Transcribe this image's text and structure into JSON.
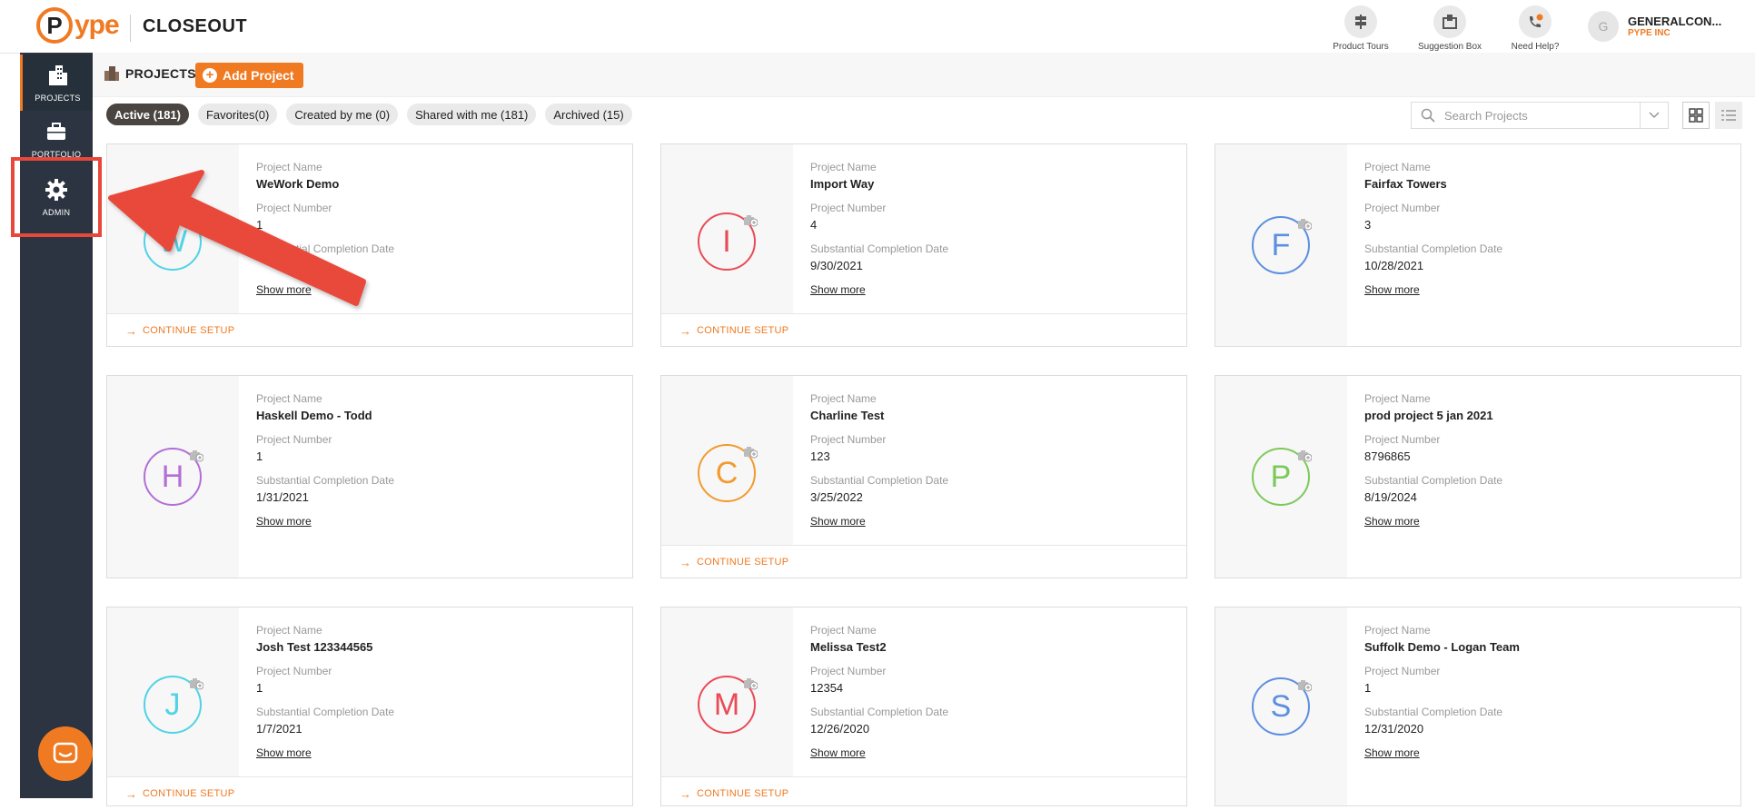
{
  "topbar": {
    "logo_text": "ype",
    "logo_letter": "P",
    "app_title": "CLOSEOUT",
    "tools": [
      {
        "label": "Product Tours",
        "icon": "signpost-icon"
      },
      {
        "label": "Suggestion Box",
        "icon": "suggestion-box-icon"
      },
      {
        "label": "Need Help?",
        "icon": "phone-help-icon"
      }
    ],
    "user": {
      "initial": "G",
      "name": "GENERALCON...",
      "company": "PYPE INC"
    }
  },
  "sidebar": {
    "items": [
      {
        "label": "PROJECTS",
        "icon": "buildings-icon"
      },
      {
        "label": "PORTFOLIO",
        "icon": "briefcase-icon"
      },
      {
        "label": "ADMIN",
        "icon": "gear-icon"
      }
    ]
  },
  "header": {
    "title": "PROJECTS",
    "add_label": "Add Project"
  },
  "filters": [
    {
      "label": "Active (181)",
      "active": true
    },
    {
      "label": "Favorites(0)",
      "active": false
    },
    {
      "label": "Created by me (0)",
      "active": false
    },
    {
      "label": "Shared with me (181)",
      "active": false
    },
    {
      "label": "Archived (15)",
      "active": false
    }
  ],
  "search": {
    "placeholder": "Search Projects"
  },
  "field_labels": {
    "name": "Project Name",
    "number": "Project Number",
    "date": "Substantial Completion Date",
    "show_more": "Show more",
    "continue": "CONTINUE SETUP"
  },
  "projects": [
    {
      "initial": "W",
      "color": "#4fd3e6",
      "name": "WeWork Demo",
      "number": "1",
      "date": "",
      "continue": true
    },
    {
      "initial": "I",
      "color": "#e94b57",
      "name": "Import Way",
      "number": "4",
      "date": "9/30/2021",
      "continue": true
    },
    {
      "initial": "F",
      "color": "#5b8fe0",
      "name": "Fairfax Towers",
      "number": "3",
      "date": "10/28/2021",
      "continue": false
    },
    {
      "initial": "H",
      "color": "#b26fd6",
      "name": "Haskell Demo - Todd",
      "number": "1",
      "date": "1/31/2021",
      "continue": false
    },
    {
      "initial": "C",
      "color": "#f39a2e",
      "name": "Charline Test",
      "number": "123",
      "date": "3/25/2022",
      "continue": true
    },
    {
      "initial": "P",
      "color": "#7cc95a",
      "name": "prod project 5 jan 2021",
      "number": "8796865",
      "date": "8/19/2024",
      "continue": false
    },
    {
      "initial": "J",
      "color": "#4fd3e6",
      "name": "Josh Test 123344565",
      "number": "1",
      "date": "1/7/2021",
      "continue": true
    },
    {
      "initial": "M",
      "color": "#e94b57",
      "name": "Melissa Test2",
      "number": "12354",
      "date": "12/26/2020",
      "continue": true
    },
    {
      "initial": "S",
      "color": "#5b8fe0",
      "name": "Suffolk Demo - Logan Team",
      "number": "1",
      "date": "12/31/2020",
      "continue": false
    }
  ],
  "annotation": {
    "color": "#e8483a"
  }
}
